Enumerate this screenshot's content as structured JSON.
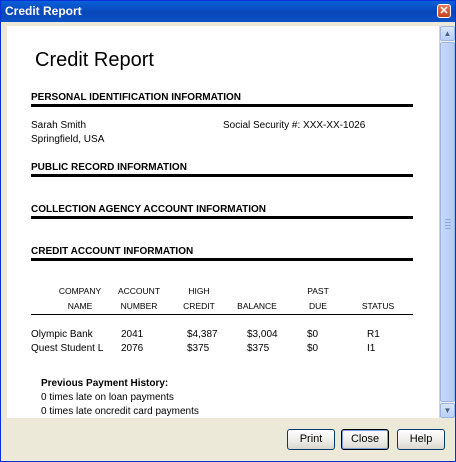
{
  "window": {
    "title": "Credit Report"
  },
  "document": {
    "title": "Credit Report",
    "sections": {
      "personal": "PERSONAL IDENTIFICATION INFORMATION",
      "public_record": "PUBLIC RECORD INFORMATION",
      "collection": "COLLECTION AGENCY ACCOUNT INFORMATION",
      "credit_account": "CREDIT ACCOUNT INFORMATION"
    },
    "person": {
      "name": "Sarah Smith",
      "location": "Springfield, USA",
      "ssn": "Social Security #: XXX-XX-1026"
    },
    "table": {
      "headers": [
        {
          "line1": "COMPANY",
          "line2": "NAME"
        },
        {
          "line1": "ACCOUNT",
          "line2": "NUMBER"
        },
        {
          "line1": "HIGH",
          "line2": "CREDIT"
        },
        {
          "line1": "",
          "line2": "BALANCE"
        },
        {
          "line1": "PAST",
          "line2": "DUE"
        },
        {
          "line1": "",
          "line2": "STATUS"
        }
      ],
      "rows": [
        [
          "Olympic Bank",
          "2041",
          "$4,387",
          "$3,004",
          "$0",
          "R1"
        ],
        [
          "Quest Student L",
          "2076",
          "$375",
          "$375",
          "$0",
          "I1"
        ]
      ]
    },
    "history": {
      "heading": "Previous Payment History:",
      "lines": [
        "0 times late on loan payments",
        "0 times late oncredit card payments"
      ]
    }
  },
  "buttons": {
    "print": "Print",
    "close": "Close",
    "help": "Help"
  },
  "icons": {
    "close_window": "close-icon",
    "scroll_up": "chevron-up-icon",
    "scroll_down": "chevron-down-icon"
  },
  "colors": {
    "titlebar": "#0846b8",
    "window_bg": "#ece9d8",
    "close_button": "#c4431e"
  }
}
